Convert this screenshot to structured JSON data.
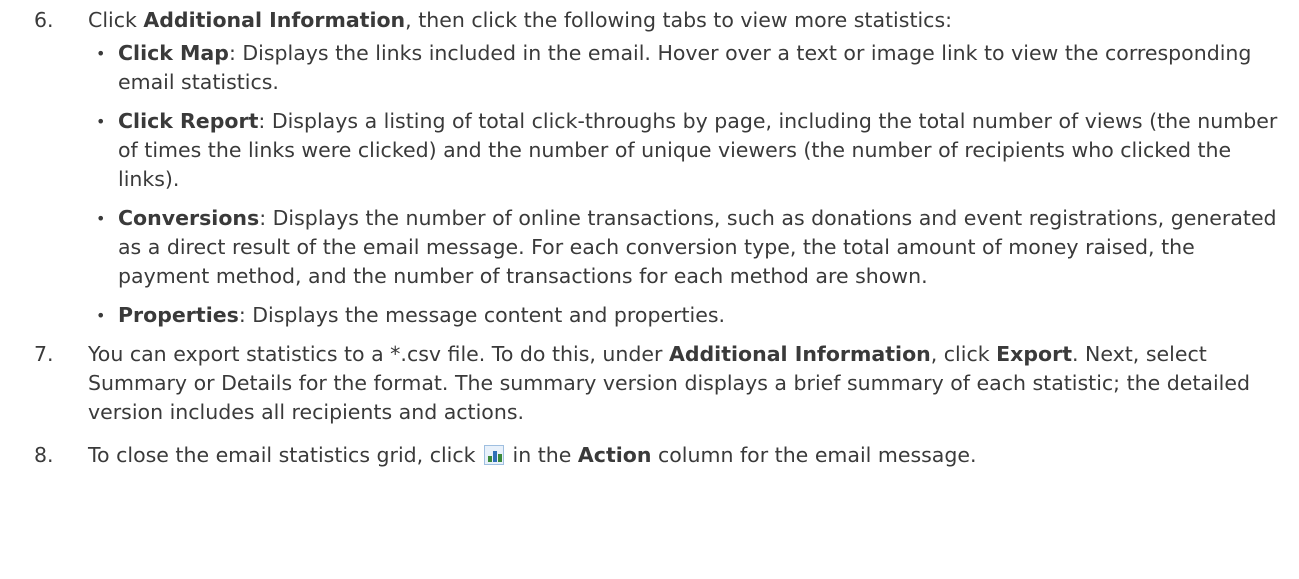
{
  "steps": {
    "step6": {
      "number": "6.",
      "pre": "Click ",
      "bold": "Additional Information",
      "post": ", then click the following tabs to view more statistics:",
      "items": [
        {
          "term": "Click Map",
          "desc": ": Displays the links included in the email. Hover over a text or image link to view the corresponding email statistics."
        },
        {
          "term": "Click Report",
          "desc": ": Displays a listing of total click-throughs by page, including the total number of views (the number of times the links were clicked) and the number of unique viewers (the number of recipients who clicked the links)."
        },
        {
          "term": "Conversions",
          "desc": ": Displays the number of online transactions, such as donations and event registrations, generated as a direct result of the email message. For each conversion type, the total amount of money raised, the payment method, and the number of transactions for each method are shown."
        },
        {
          "term": "Properties",
          "desc": ": Displays the message content and properties."
        }
      ]
    },
    "step7": {
      "number": "7.",
      "pre": "You can export statistics to a *.csv file. To do this, under ",
      "bold1": "Additional Information",
      "mid": ", click ",
      "bold2": "Export",
      "post": ". Next, select Summary or Details for the format. The summary version displays a brief summary of each statistic; the detailed version includes all recipients and actions."
    },
    "step8": {
      "number": "8.",
      "pre": "To close the email statistics grid, click ",
      "icon": "statistics-chart-icon",
      "mid": " in the ",
      "bold": "Action",
      "post": " column for the email message."
    }
  }
}
